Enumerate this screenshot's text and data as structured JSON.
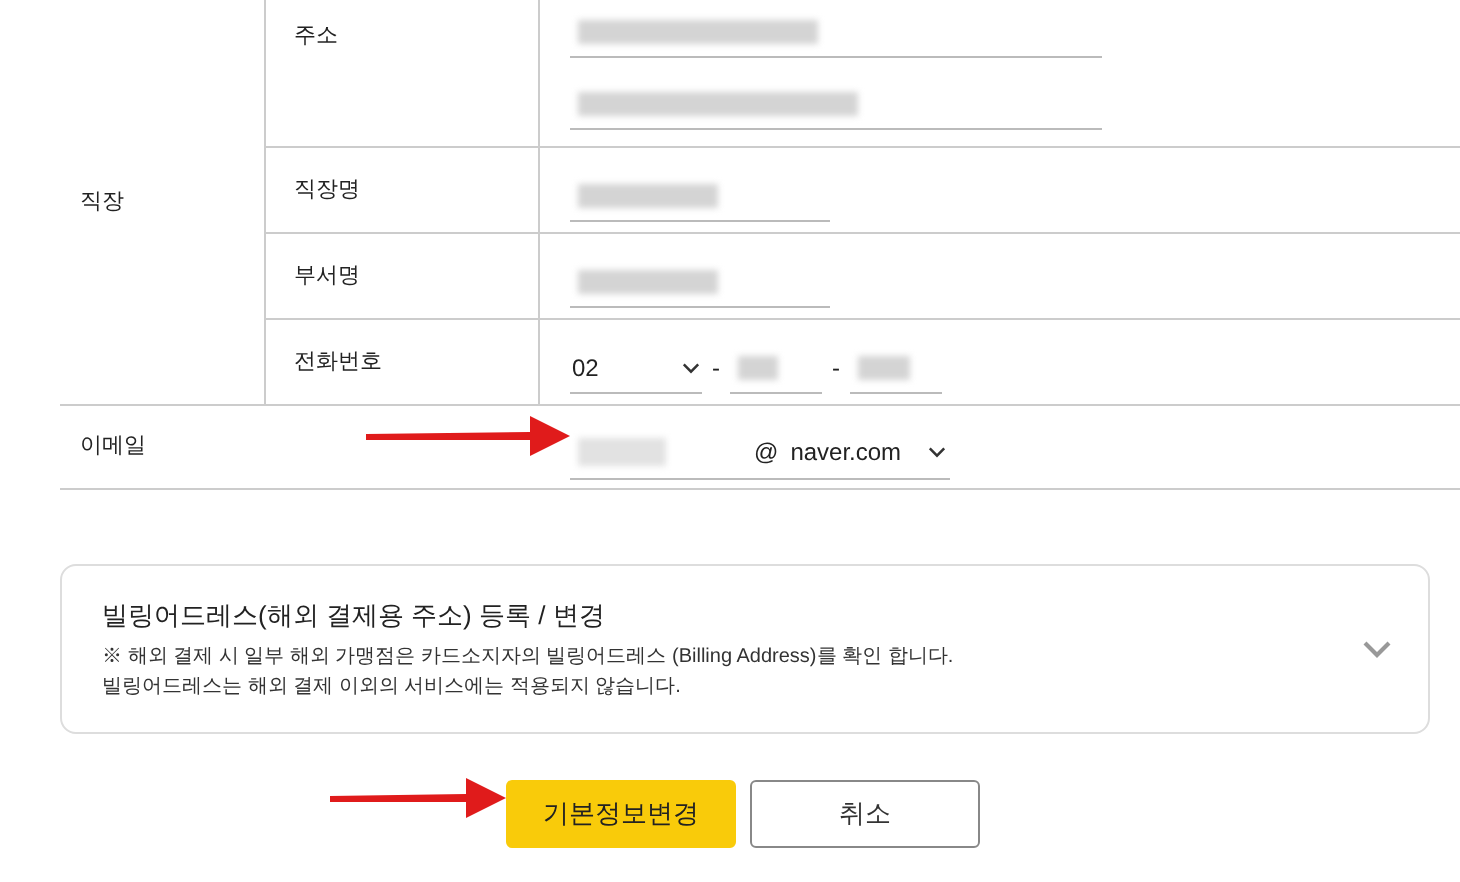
{
  "workplace": {
    "label": "직장",
    "rows": [
      {
        "kind": "address",
        "label": "주소"
      },
      {
        "kind": "text",
        "label": "직장명"
      },
      {
        "kind": "text",
        "label": "부서명"
      },
      {
        "kind": "phone",
        "label": "전화번호",
        "area_code": "02",
        "separators": [
          "-",
          "-"
        ]
      }
    ]
  },
  "email": {
    "label": "이메일",
    "at": "@",
    "domain": "naver.com"
  },
  "billing": {
    "title": "빌링어드레스(해외 결제용 주소) 등록 / 변경",
    "lines": [
      "※ 해외 결제 시 일부 해외 가맹점은 카드소지자의 빌링어드레스 (Billing Address)를 확인 합니다.",
      "빌링어드레스는 해외 결제 이외의 서비스에는 적용되지 않습니다."
    ],
    "expanded": false
  },
  "buttons": [
    {
      "label": "기본정보변경",
      "kind": "primary"
    },
    {
      "label": "취소",
      "kind": "secondary"
    }
  ]
}
